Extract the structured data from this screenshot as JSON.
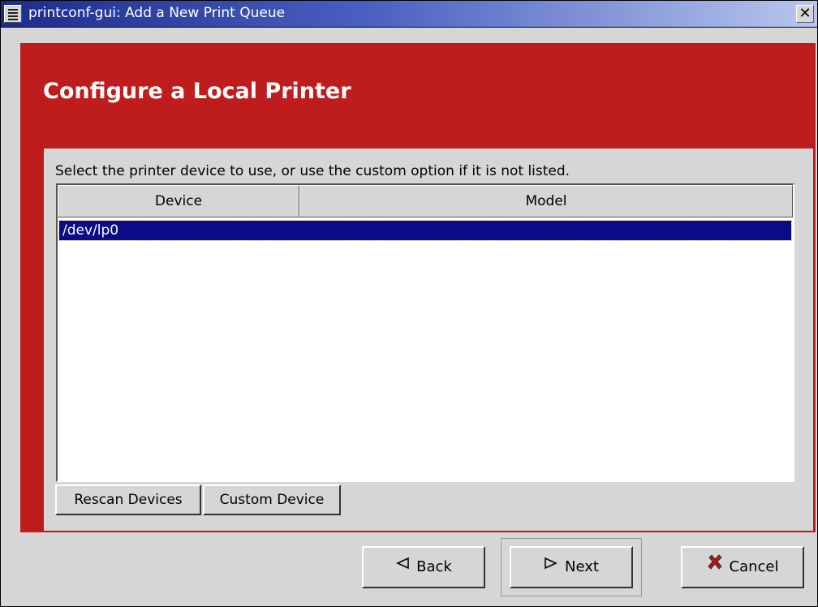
{
  "window": {
    "title": "printconf-gui: Add a New Print Queue",
    "menu_icon": "window-menu-icon",
    "close_icon": "close-icon",
    "close_glyph": "✕"
  },
  "header": {
    "title": "Configure a Local Printer",
    "accent_color": "#bf1d1d"
  },
  "main": {
    "instruction": "Select the printer device to use, or use the custom option if it is not listed.",
    "table": {
      "columns": [
        "Device",
        "Model"
      ],
      "rows": [
        {
          "device": "/dev/lp0",
          "model": "",
          "selected": true
        }
      ],
      "selection_color": "#0b0b88"
    },
    "rescan_label": "Rescan Devices",
    "custom_label": "Custom Device"
  },
  "footer": {
    "back_label": "Back",
    "back_icon": "arrow-left-icon",
    "next_label": "Next",
    "next_icon": "arrow-right-icon",
    "cancel_label": "Cancel",
    "cancel_icon": "cancel-x-icon"
  }
}
